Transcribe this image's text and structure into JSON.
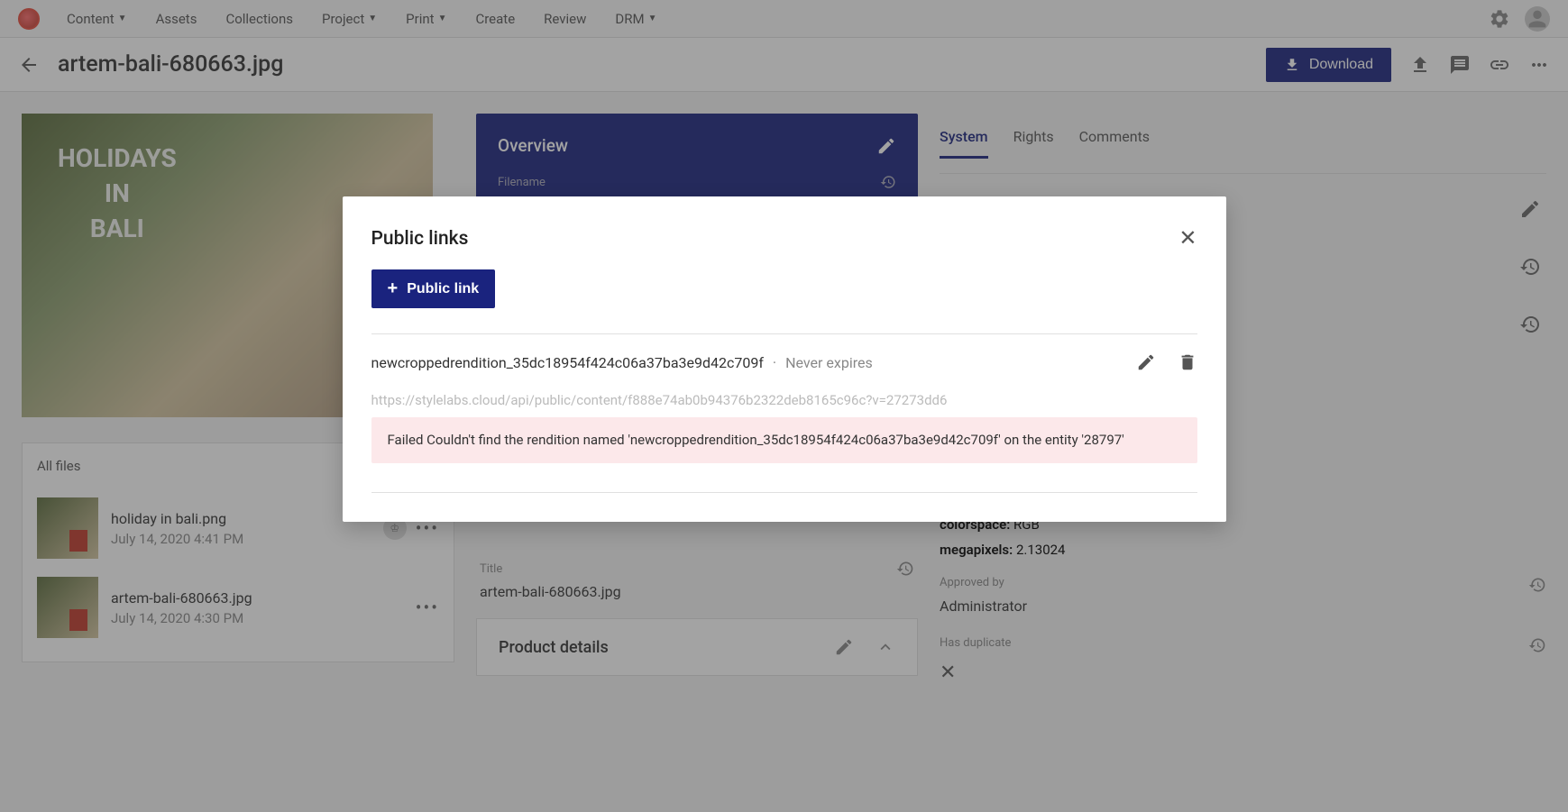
{
  "nav": {
    "items": [
      "Content",
      "Assets",
      "Collections",
      "Project",
      "Print",
      "Create",
      "Review",
      "DRM"
    ],
    "dropdowns": [
      true,
      false,
      false,
      true,
      true,
      false,
      false,
      true
    ]
  },
  "page": {
    "title": "artem-bali-680663.jpg",
    "download_label": "Download"
  },
  "preview": {
    "overlay_text": "HOLIDAYS\nIN\nBALI"
  },
  "allfiles": {
    "title": "All files",
    "items": [
      {
        "name": "holiday in bali.png",
        "date": "July 14, 2020 4:41 PM",
        "crown": true
      },
      {
        "name": "artem-bali-680663.jpg",
        "date": "July 14, 2020 4:30 PM",
        "crown": false
      }
    ]
  },
  "overview": {
    "title": "Overview",
    "filename_label": "Filename"
  },
  "meta": {
    "title_label": "Title",
    "title_value": "artem-bali-680663.jpg"
  },
  "product_details": {
    "title": "Product details"
  },
  "tabs": [
    "System",
    "Rights",
    "Comments"
  ],
  "metadata": {
    "colorspace_key": "colorspace:",
    "colorspace_val": " RGB",
    "megapixels_key": "megapixels:",
    "megapixels_val": " 2.13024",
    "approved_label": "Approved by",
    "approved_val": "Administrator",
    "dup_label": "Has duplicate"
  },
  "modal": {
    "title": "Public links",
    "button_label": "Public link",
    "link": {
      "name": "newcroppedrendition_35dc18954f424c06a37ba3e9d42c709f",
      "expires": "Never expires",
      "url": "https://stylelabs.cloud/api/public/content/f888e74ab0b94376b2322deb8165c96c?v=27273dd6",
      "error": "Failed Couldn't find the rendition named 'newcroppedrendition_35dc18954f424c06a37ba3e9d42c709f' on the entity '28797'"
    }
  }
}
